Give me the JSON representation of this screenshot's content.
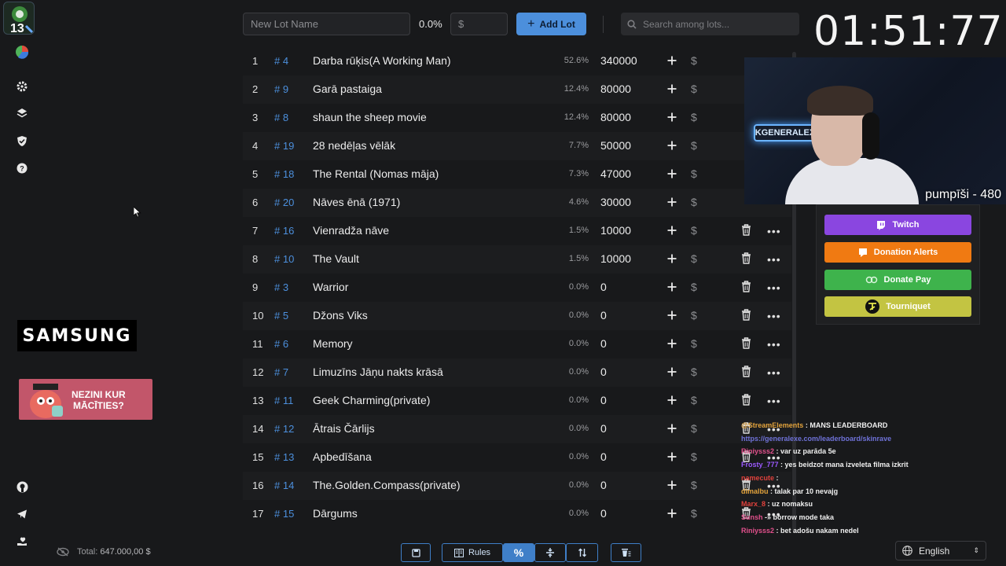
{
  "topbar": {
    "lot_name_placeholder": "New Lot Name",
    "percent": "0.0%",
    "amount_placeholder": "$",
    "add_lot_label": "Add Lot",
    "search_placeholder": "Search among lots..."
  },
  "timer": "01:51:77",
  "lots": [
    {
      "idx": "1",
      "id": "# 4",
      "name": "Darba rūķis(A Working Man)",
      "pct": "52.6%",
      "amount": "340000"
    },
    {
      "idx": "2",
      "id": "# 9",
      "name": "Garā pastaiga",
      "pct": "12.4%",
      "amount": "80000"
    },
    {
      "idx": "3",
      "id": "# 8",
      "name": "shaun the sheep movie",
      "pct": "12.4%",
      "amount": "80000"
    },
    {
      "idx": "4",
      "id": "# 19",
      "name": "28 nedēļas vēlāk",
      "pct": "7.7%",
      "amount": "50000"
    },
    {
      "idx": "5",
      "id": "# 18",
      "name": "The Rental (Nomas māja)",
      "pct": "7.3%",
      "amount": "47000"
    },
    {
      "idx": "6",
      "id": "# 20",
      "name": "Nāves ēnā (1971)",
      "pct": "4.6%",
      "amount": "30000"
    },
    {
      "idx": "7",
      "id": "# 16",
      "name": "Vienradža nāve",
      "pct": "1.5%",
      "amount": "10000"
    },
    {
      "idx": "8",
      "id": "# 10",
      "name": "The Vault",
      "pct": "1.5%",
      "amount": "10000"
    },
    {
      "idx": "9",
      "id": "# 3",
      "name": "Warrior",
      "pct": "0.0%",
      "amount": "0"
    },
    {
      "idx": "10",
      "id": "# 5",
      "name": "Džons Viks",
      "pct": "0.0%",
      "amount": "0"
    },
    {
      "idx": "11",
      "id": "# 6",
      "name": "Memory",
      "pct": "0.0%",
      "amount": "0"
    },
    {
      "idx": "12",
      "id": "# 7",
      "name": "Limuzīns Jāņu nakts krāsā",
      "pct": "0.0%",
      "amount": "0"
    },
    {
      "idx": "13",
      "id": "# 11",
      "name": "Geek Charming(private)",
      "pct": "0.0%",
      "amount": "0"
    },
    {
      "idx": "14",
      "id": "# 12",
      "name": "Ātrais Čārlijs",
      "pct": "0.0%",
      "amount": "0"
    },
    {
      "idx": "15",
      "id": "# 13",
      "name": "Apbedīšana",
      "pct": "0.0%",
      "amount": "0"
    },
    {
      "idx": "16",
      "id": "# 14",
      "name": "The.Golden.Compass(private)",
      "pct": "0.0%",
      "amount": "0"
    },
    {
      "idx": "17",
      "id": "# 15",
      "name": "Dārgums",
      "pct": "0.0%",
      "amount": "0"
    }
  ],
  "webcam": {
    "caption": "pumpīši - 480",
    "sign": "KGENERALEX"
  },
  "donate_panel": {
    "twitch": "Twitch",
    "donation_alerts": "Donation Alerts",
    "donate_pay": "Donate Pay",
    "tourniquet": "Tourniquet"
  },
  "sponsors": {
    "samsung": "SAMSUNG",
    "ad_line1": "NEZINI KUR",
    "ad_line2": "MĀCĪTIES?"
  },
  "chat": [
    {
      "user": "@StreamElements",
      "user_color": "#e3a33c",
      "msg": ": MANS LEADERBOARD"
    },
    {
      "user": "",
      "user_color": "#6f72d8",
      "msg": "https://generalexe.com/leaderboard/skinrave"
    },
    {
      "user": "Riniysss2",
      "user_color": "#e1508c",
      "msg": ": var uz parāda 5e"
    },
    {
      "user": "Frosty_777",
      "user_color": "#9b59ff",
      "msg": ": yes beidzot mana izveleta filma izkrit"
    },
    {
      "user": "namecute",
      "user_color": "#e0413c",
      "msg": ":"
    },
    {
      "user": "dimalbu",
      "user_color": "#e3a33c",
      "msg": ": talak par 10 nevajg"
    },
    {
      "user": "Marx_8",
      "user_color": "#e0413c",
      "msg": ": uz nomaksu"
    },
    {
      "user": "Sunsh",
      "user_color": "#e1508c",
      "msg": "-» borrow mode taka"
    },
    {
      "user": "Riniysss2",
      "user_color": "#e1508c",
      "msg": ": bet adošu nakam nedel"
    }
  ],
  "footer": {
    "total_label": "Total:",
    "total_value": "647.000,00 $",
    "rules_label": "Rules",
    "language": "English"
  },
  "colors": {
    "accent": "#4c8fdc",
    "twitch": "#8a46e0",
    "donation_alerts": "#f07a12",
    "donate_pay": "#3eb34c",
    "tourniquet": "#c3c442"
  }
}
